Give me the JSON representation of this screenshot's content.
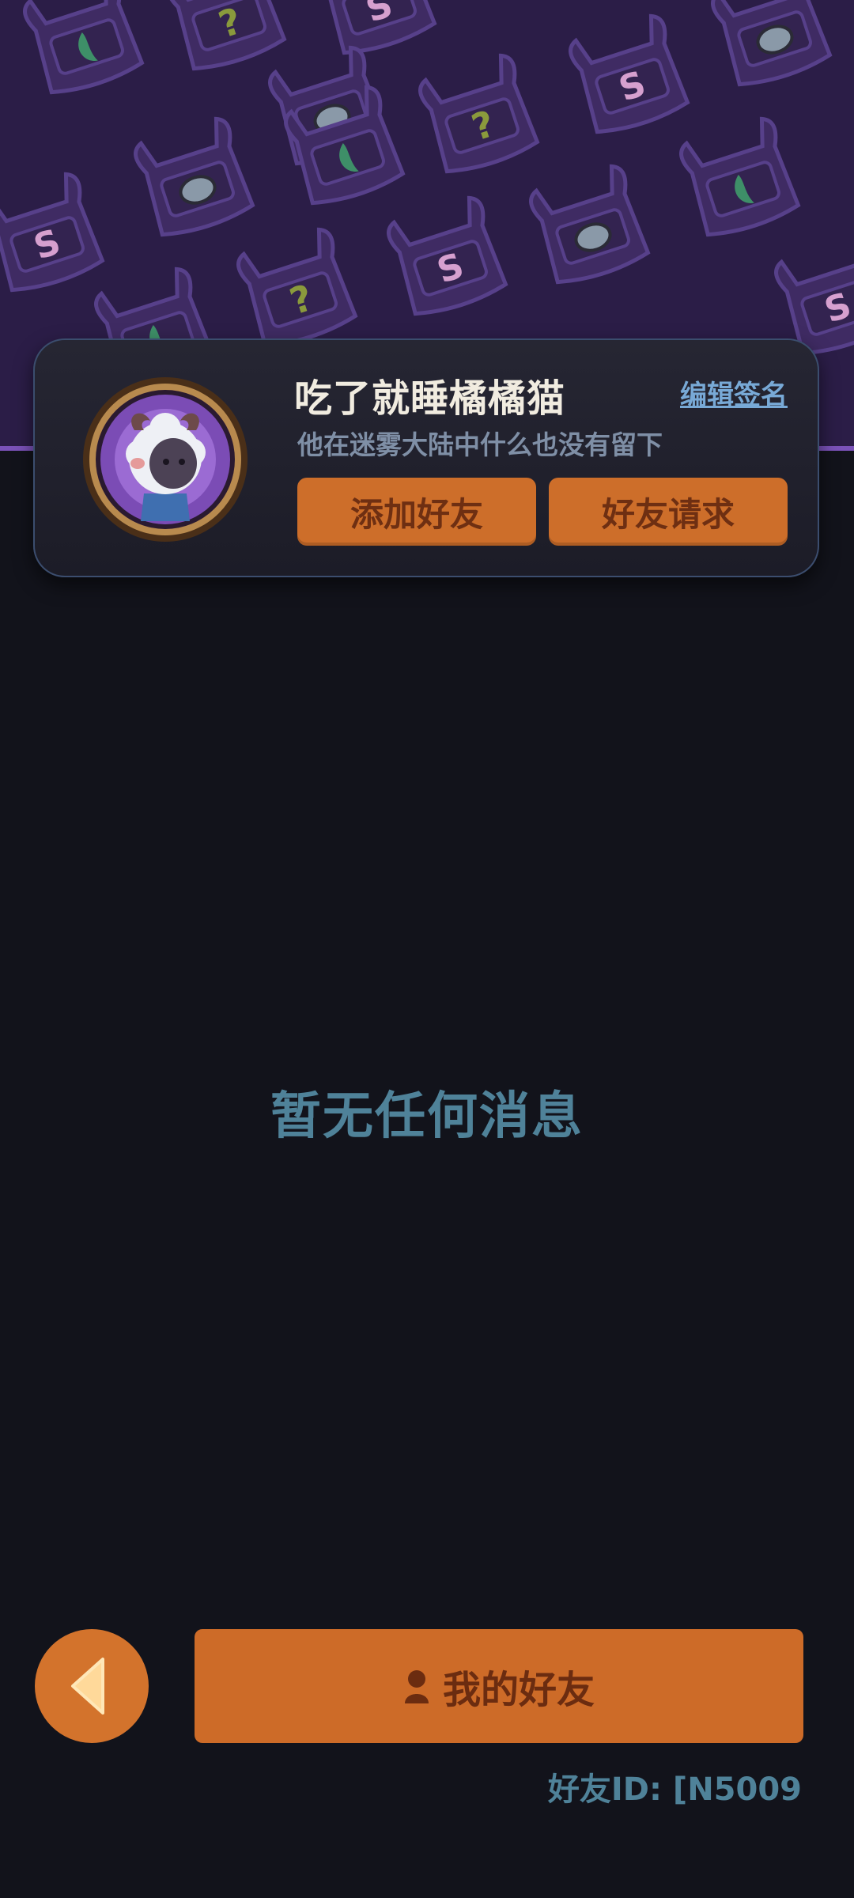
{
  "profile": {
    "username": "吃了就睡橘橘猫",
    "edit_signature_label": "编辑签名",
    "signature": "他在迷雾大陆中什么也没有留下",
    "add_friend_label": "添加好友",
    "friend_requests_label": "好友请求"
  },
  "main": {
    "empty_message": "暂无任何消息"
  },
  "bottom": {
    "my_friends_label": "我的好友",
    "friend_id_text": "好友ID: [N5009"
  },
  "icons": {
    "back": "back-arrow-icon",
    "person": "person-icon",
    "banner_tiles": [
      "question-mark-icon",
      "s-icon",
      "eye-icon",
      "leaf-icon"
    ]
  },
  "colors": {
    "background": "#12131b",
    "banner": "#2b1d47",
    "accent_orange": "#cd6e2a",
    "button_text": "#6e2f12",
    "muted_teal": "#4f8299",
    "link_blue": "#78a9d6"
  }
}
